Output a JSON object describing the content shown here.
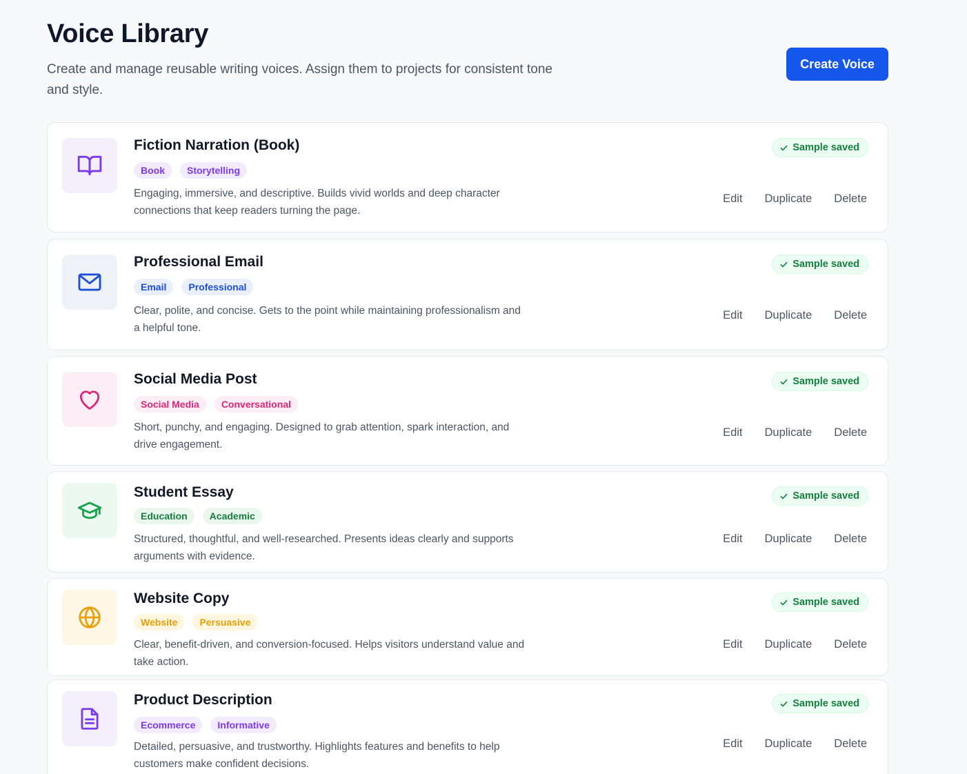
{
  "header": {
    "title": "Voice Library",
    "subtitle": "Create and manage reusable writing voices. Assign them to projects for consistent tone and style.",
    "create_label": "Create Voice"
  },
  "colors": {
    "primary": "#1557ea",
    "success": "#15803d"
  },
  "voices": [
    {
      "name": "Fiction Narration (Book)",
      "icon": "book-open-icon",
      "tags": [
        "Book",
        "Storytelling"
      ],
      "description": "Engaging, immersive, and descriptive. Builds vivid worlds and deep character connections that keep readers turning the page.",
      "status": "Sample saved",
      "accent": "#7c3aed",
      "icon_bg": "#f3effd",
      "tag_bg": "#f1ebfd",
      "tag_color": "#7c3aed"
    },
    {
      "name": "Professional Email",
      "icon": "mail-icon",
      "tags": [
        "Email",
        "Professional"
      ],
      "description": "Clear, polite, and concise. Gets to the point while maintaining professionalism and a helpful tone.",
      "status": "Sample saved",
      "accent": "#1d4ed8",
      "icon_bg": "#eef2f7",
      "tag_bg": "#eaf0fb",
      "tag_color": "#1d4ed8"
    },
    {
      "name": "Social Media Post",
      "icon": "heart-icon",
      "tags": [
        "Social Media",
        "Conversational"
      ],
      "description": "Short, punchy, and engaging. Designed to grab attention, spark interaction, and drive engagement.",
      "status": "Sample saved",
      "accent": "#db2777",
      "icon_bg": "#fdeef5",
      "tag_bg": "#fdedf4",
      "tag_color": "#db2777"
    },
    {
      "name": "Student Essay",
      "icon": "graduation-cap-icon",
      "tags": [
        "Education",
        "Academic"
      ],
      "description": "Structured, thoughtful, and well-researched. Presents ideas clearly and supports arguments with evidence.",
      "status": "Sample saved",
      "accent": "#16a34a",
      "icon_bg": "#ecf9f0",
      "tag_bg": "#eaf7ee",
      "tag_color": "#15803d"
    },
    {
      "name": "Website Copy",
      "icon": "globe-icon",
      "tags": [
        "Website",
        "Persuasive"
      ],
      "description": "Clear, benefit-driven, and conversion-focused. Helps visitors understand value and take action.",
      "status": "Sample saved",
      "accent": "#eaa00a",
      "icon_bg": "#fff7e6",
      "tag_bg": "#fff6e0",
      "tag_color": "#e5a008"
    },
    {
      "name": "Product Description",
      "icon": "document-icon",
      "tags": [
        "Ecommerce",
        "Informative"
      ],
      "description": "Detailed, persuasive, and trustworthy. Highlights features and benefits to help customers make confident decisions.",
      "status": "Sample saved",
      "accent": "#7c3aed",
      "icon_bg": "#f3effd",
      "tag_bg": "#f1ebfd",
      "tag_color": "#7c3aed"
    }
  ],
  "actions": {
    "edit": "Edit",
    "duplicate": "Duplicate",
    "delete": "Delete"
  }
}
